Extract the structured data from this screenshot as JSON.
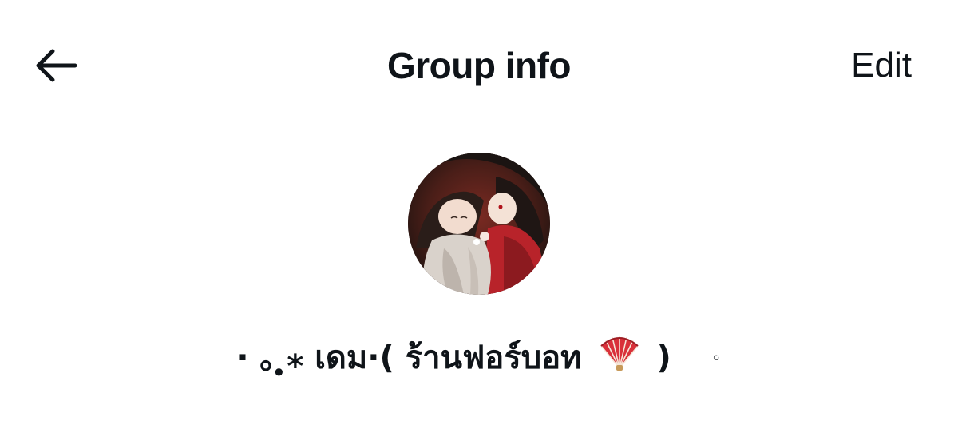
{
  "header": {
    "back_icon": "arrow-left-icon",
    "title": "Group info",
    "edit_label": "Edit"
  },
  "group": {
    "avatar": "group-avatar-illustration",
    "name_prefix": "· ｡ ̣̣̥⁎ เดม·( ร้านฟอร์บอท",
    "name_emoji_icon": "folding-fan-icon",
    "name_suffix": ")",
    "name_tail": "◦"
  },
  "colors": {
    "text": "#0f1419",
    "background": "#ffffff",
    "fan_red": "#d9313a"
  }
}
